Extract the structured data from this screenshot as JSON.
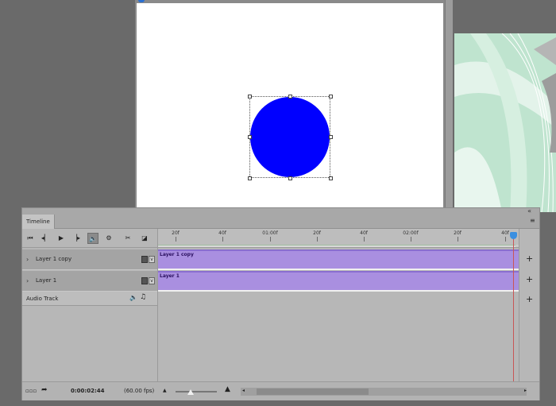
{
  "timeline": {
    "tab_label": "Timeline",
    "collapse_glyph": "«",
    "controls": [
      {
        "name": "go-to-first-frame-icon",
        "glyph": "⏮"
      },
      {
        "name": "previous-frame-icon",
        "glyph": "◂▏"
      },
      {
        "name": "play-icon",
        "glyph": "▶"
      },
      {
        "name": "next-frame-icon",
        "glyph": "▕▸"
      },
      {
        "name": "audio-toggle-icon",
        "glyph": "🔈"
      },
      {
        "name": "settings-icon",
        "glyph": "⚙"
      },
      {
        "name": "split-scissors-icon",
        "glyph": "✂"
      },
      {
        "name": "transition-icon",
        "glyph": "◪"
      }
    ],
    "layers": [
      {
        "name": "Layer 1 copy",
        "clip_label": "Layer 1 copy"
      },
      {
        "name": "Layer 1",
        "clip_label": "Layer 1"
      }
    ],
    "audio_track": {
      "label": "Audio Track"
    },
    "ruler_labels": [
      "20f",
      "40f",
      "01:00f",
      "20f",
      "40f",
      "02:00f",
      "20f",
      "40f"
    ],
    "timecode": "0:00:02:44",
    "fps": "(60.00 fps)"
  },
  "colors": {
    "circle": "#0000ff",
    "clip": "#a98fe0",
    "playhead": "#3b8fe0"
  }
}
